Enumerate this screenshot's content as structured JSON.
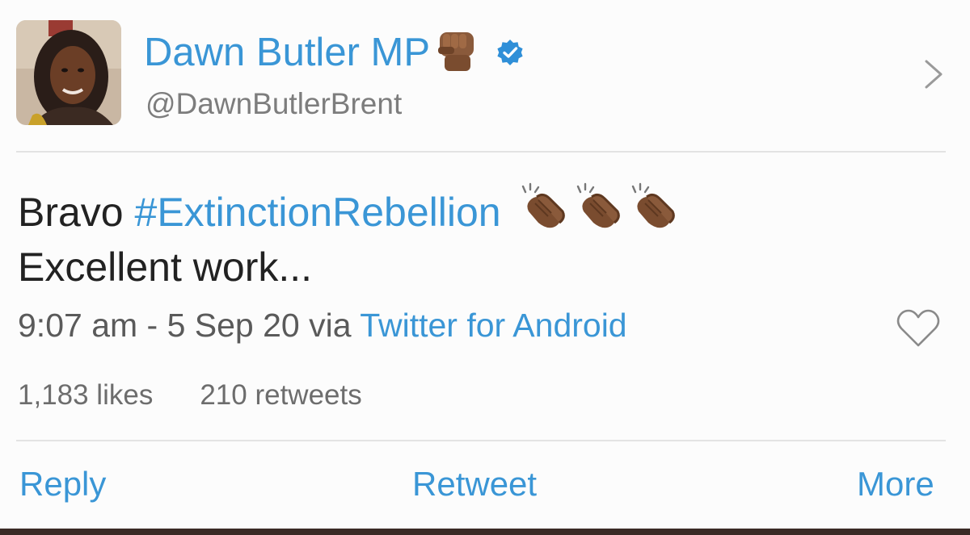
{
  "author": {
    "display_name": "Dawn Butler MP",
    "handle": "@DawnButlerBrent",
    "name_emoji": "raised-fist-icon",
    "verified_icon": "verified-badge-icon"
  },
  "tweet": {
    "text_prefix": "Bravo ",
    "hashtag": "#ExtinctionRebellion",
    "emoji": [
      "clapping-hands-icon",
      "clapping-hands-icon",
      "clapping-hands-icon"
    ],
    "text_line2": "Excellent work...",
    "timestamp": "9:07 am - 5 Sep 20 via ",
    "source": "Twitter for Android"
  },
  "stats": {
    "likes": "1,183 likes",
    "retweets": "210 retweets"
  },
  "actions": {
    "reply": "Reply",
    "retweet": "Retweet",
    "more": "More"
  },
  "colors": {
    "link_blue": "#3a96d6",
    "text_dark": "#222222",
    "text_gray": "#7d7d7d",
    "divider": "#e3e3e3",
    "skin_tone": "#8a5a3b"
  }
}
